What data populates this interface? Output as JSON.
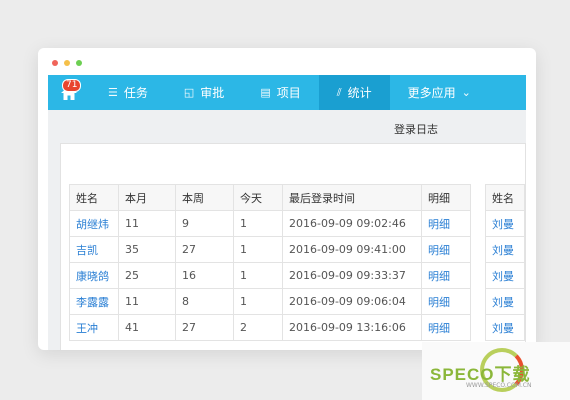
{
  "window": {
    "dot_colors": [
      "#f0645a",
      "#f5c04a",
      "#6ccf52"
    ]
  },
  "nav": {
    "badge": "71",
    "items": [
      {
        "label": "任务",
        "icon": "list-icon"
      },
      {
        "label": "审批",
        "icon": "approval-icon"
      },
      {
        "label": "项目",
        "icon": "project-icon"
      },
      {
        "label": "统计",
        "icon": "chart-icon",
        "active": true
      },
      {
        "label": "更多应用",
        "icon": "chevron-down-icon"
      }
    ]
  },
  "page": {
    "title": "登录日志"
  },
  "table": {
    "headers": [
      "姓名",
      "本月",
      "本周",
      "今天",
      "最后登录时间",
      "明细"
    ],
    "rows": [
      {
        "name": "胡继炜",
        "month": "11",
        "week": "9",
        "today": "1",
        "last": "2016-09-09 09:02:46",
        "detail": "明细"
      },
      {
        "name": "吉凯",
        "month": "35",
        "week": "27",
        "today": "1",
        "last": "2016-09-09 09:41:00",
        "detail": "明细"
      },
      {
        "name": "康晓鸽",
        "month": "25",
        "week": "16",
        "today": "1",
        "last": "2016-09-09 09:33:37",
        "detail": "明细"
      },
      {
        "name": "李露露",
        "month": "11",
        "week": "8",
        "today": "1",
        "last": "2016-09-09 09:06:04",
        "detail": "明细"
      },
      {
        "name": "王冲",
        "month": "41",
        "week": "27",
        "today": "2",
        "last": "2016-09-09 13:16:06",
        "detail": "明细"
      }
    ]
  },
  "table2": {
    "header": "姓名",
    "rows": [
      "刘曼",
      "刘曼",
      "刘曼",
      "刘曼",
      "刘曼"
    ]
  },
  "watermark": {
    "text": "SPECO下载",
    "sub": "WWW.SPECO.COM.CN"
  }
}
